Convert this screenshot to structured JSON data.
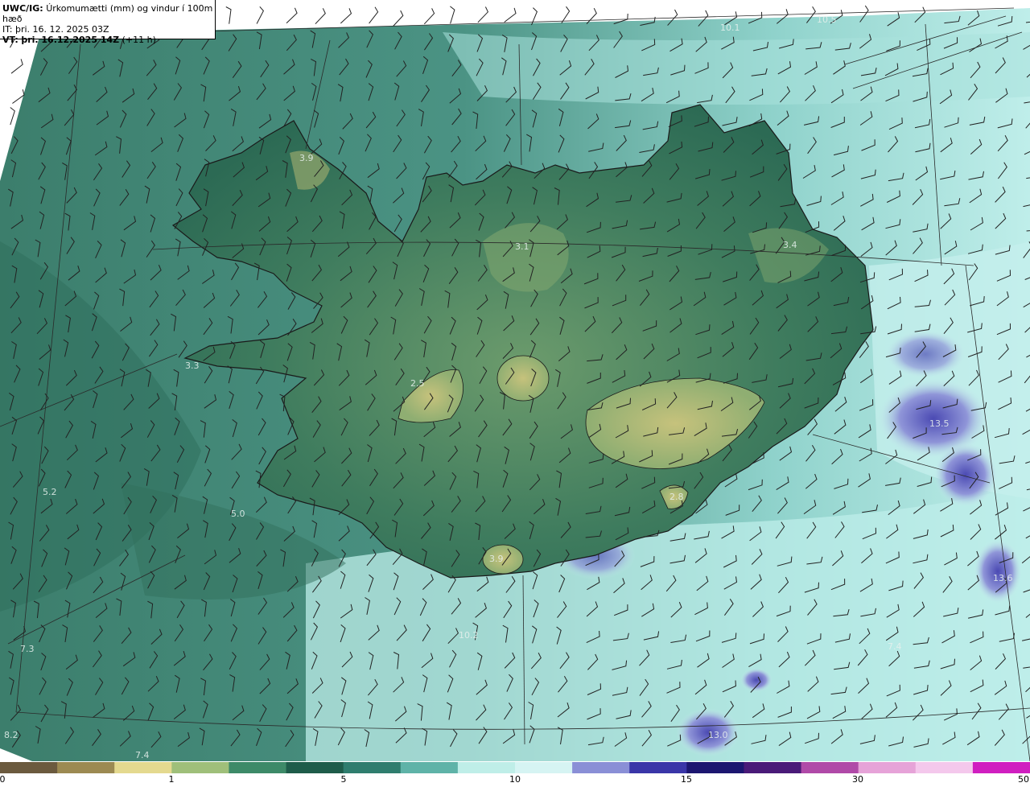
{
  "header": {
    "model": "UWC/IG:",
    "title": "Úrkomumætti (mm) og vindur í 100m hæð",
    "initial_time": "IT: þri. 16. 12. 2025 03Z",
    "valid_prefix": "VT:",
    "valid_time": "þri. 16.12.2025 14Z",
    "valid_offset": "(+11 h)"
  },
  "value_labels": [
    "10.1",
    "10.5",
    "3.9",
    "3.1",
    "3.4",
    "3.3",
    "2.5",
    "13.5",
    "5.2",
    "5.0",
    "2.8",
    "3.9",
    "13.6",
    "7.3",
    "10.2",
    "7.4",
    "8.2",
    "7.4",
    "13.0"
  ],
  "colorbar": {
    "ticks": [
      "0",
      "1",
      "5",
      "10",
      "15",
      "30",
      "50"
    ],
    "colors": [
      "#6b5a3e",
      "#9c8a52",
      "#e4d98f",
      "#9fbf7a",
      "#3d8a68",
      "#1e5c4a",
      "#2f7d6e",
      "#5fb3a8",
      "#bfeee8",
      "#d6f4f3",
      "#8a8fd6",
      "#3a36a8",
      "#1c1670",
      "#4a1a78",
      "#b04aa8",
      "#e6a3d8",
      "#f4c8ec",
      "#d01ec0"
    ]
  },
  "colors": {
    "land_low": "#2f6e55",
    "land_high": "#a8b873",
    "sea_moist": "#3c7e6c",
    "sea_dry": "#b6e8e4",
    "heavy_precip": "#5356b8",
    "coastline": "#1a1a1a",
    "barb": "#222222"
  }
}
